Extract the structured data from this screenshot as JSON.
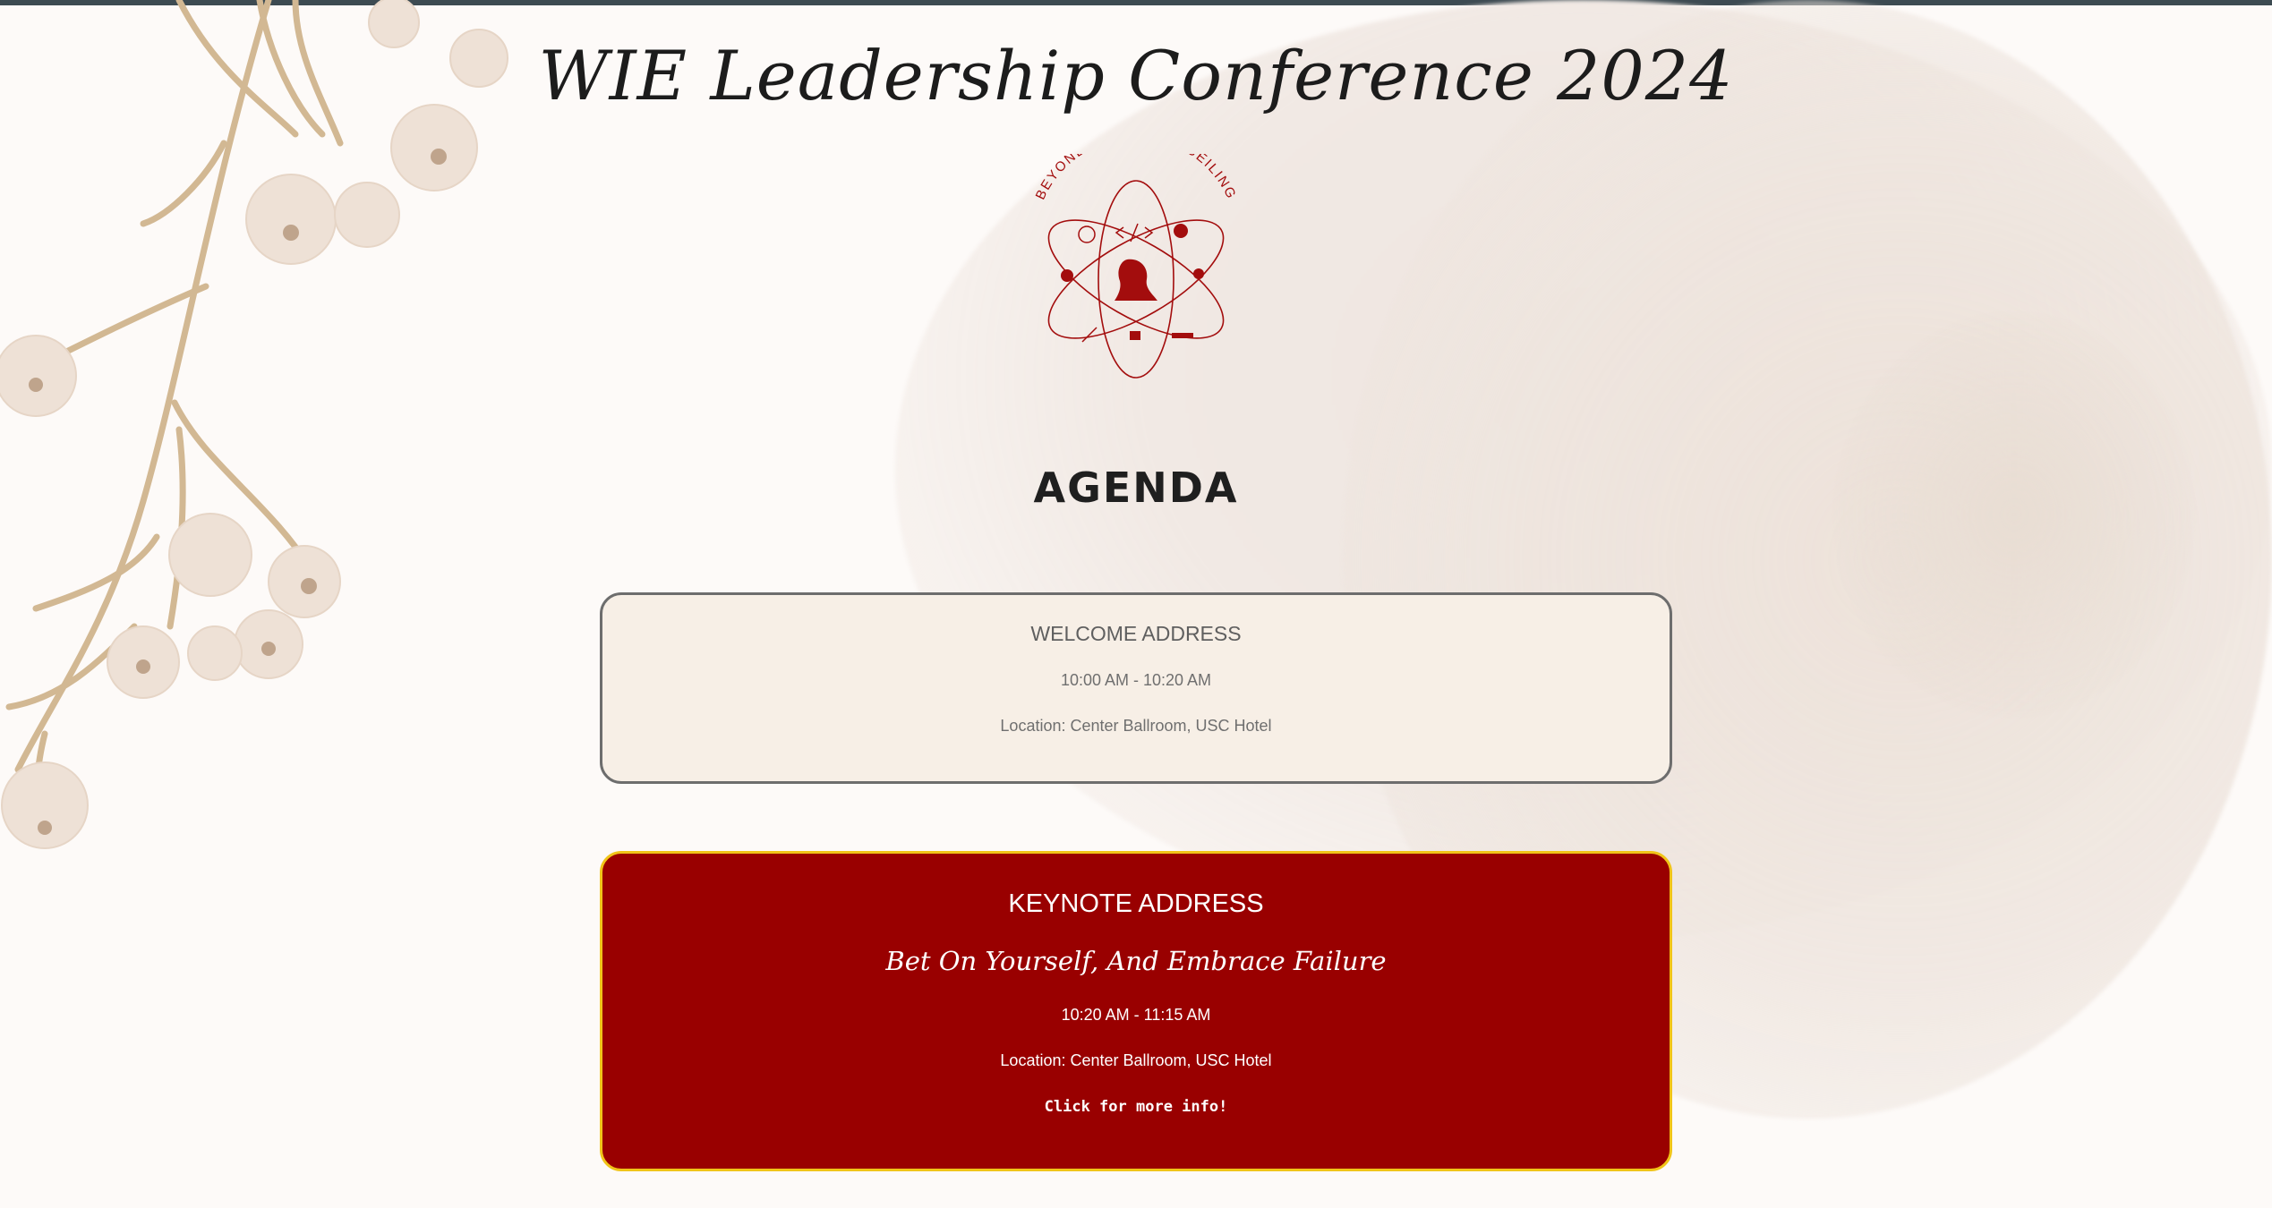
{
  "page": {
    "title": "WIE Leadership Conference 2024",
    "logo_text": "BEYOND THE GLASS CEILING",
    "agenda_heading": "AGENDA"
  },
  "colors": {
    "background": "#fdfaf8",
    "top_bar": "#3d4b52",
    "logo_red": "#a30d0d",
    "welcome_bg": "#f7efe6",
    "welcome_border": "#6d6d6d",
    "keynote_bg": "#990000",
    "keynote_border": "#f0c419"
  },
  "agenda": [
    {
      "title": "WELCOME ADDRESS",
      "time": "10:00 AM - 10:20 AM",
      "location": "Location: Center Ballroom, USC Hotel"
    },
    {
      "title": "KEYNOTE ADDRESS",
      "subtitle": "Bet On Yourself, And Embrace Failure",
      "time": "10:20 AM - 11:15 AM",
      "location": "Location: Center Ballroom, USC Hotel",
      "more_link": "Click for more info!"
    }
  ]
}
